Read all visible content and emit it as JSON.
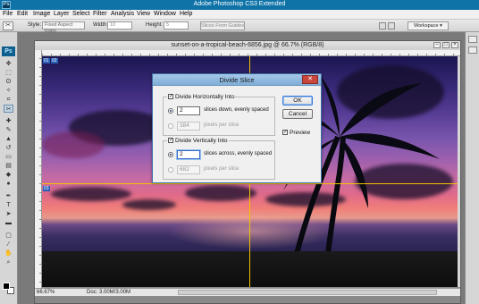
{
  "app": {
    "logo_text": "Ps",
    "title": "Adobe Photoshop CS3 Extended"
  },
  "menu": [
    "File",
    "Edit",
    "Image",
    "Layer",
    "Select",
    "Filter",
    "Analysis",
    "View",
    "Window",
    "Help"
  ],
  "options_bar": {
    "style_label": "Style:",
    "style_value": "Fixed Aspect Ratio",
    "width_label": "Width:",
    "width_value": "10",
    "height_label": "Height:",
    "height_value": "5",
    "slices_button": "Slices From Guides",
    "workspace_label": "Workspace ▾"
  },
  "toolbox": {
    "badge": "Ps",
    "tools": [
      "move-icon",
      "marquee-icon",
      "lasso-icon",
      "magic-wand-icon",
      "crop-icon",
      "slice-icon",
      "healing-icon",
      "brush-icon",
      "stamp-icon",
      "history-brush-icon",
      "eraser-icon",
      "gradient-icon",
      "blur-icon",
      "dodge-icon",
      "pen-icon",
      "type-icon",
      "path-select-icon",
      "shape-icon",
      "notes-icon",
      "eyedropper-icon",
      "hand-icon",
      "zoom-icon"
    ],
    "active_tool": "slice-icon"
  },
  "document": {
    "title": "sunset-on-a-tropical-beach-6856.jpg @ 66.7% (RGB/8)",
    "slice_labels": [
      "01",
      "02",
      "03"
    ],
    "zoom": "66.67%",
    "doc_info": "Doc: 3.00M/3.00M"
  },
  "dialog": {
    "title": "Divide Slice",
    "close": "✕",
    "horizontal": {
      "heading": "Divide Horizontally Into",
      "checked": true,
      "slices_value": "2",
      "slices_label": "slices down, evenly spaced",
      "pixels_value": "384",
      "pixels_label": "pixels per slice"
    },
    "vertical": {
      "heading": "Divide Vertically Into",
      "checked": true,
      "slices_value": "2",
      "slices_label": "slices across, evenly spaced",
      "pixels_value": "682",
      "pixels_label": "pixels per slice"
    },
    "ok": "OK",
    "cancel": "Cancel",
    "preview_label": "Preview",
    "preview_checked": true
  }
}
